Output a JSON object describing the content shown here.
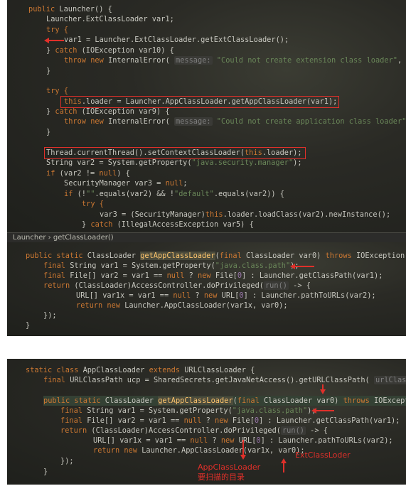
{
  "panel1": {
    "l1": [
      "public",
      " Launcher() {"
    ],
    "l2": "Launcher.ExtClassLoader var1;",
    "l3": "try {",
    "l4": "var1 = Launcher.ExtClassLoader.getExtClassLoader();",
    "l5": [
      "} ",
      "catch",
      " (IOException var10) {"
    ],
    "l6": [
      "throw new",
      " InternalError( ",
      "message:",
      " \"Could not create extension class loader\"",
      ", var"
    ],
    "l7": "}",
    "l8": "try {",
    "l9": [
      "this",
      ".loader = Launcher.AppClassLoader.getAppClassLoader(var1);"
    ],
    "l10": [
      "} ",
      "catch",
      " (IOException var9) {"
    ],
    "l11": [
      "throw new",
      " InternalError( ",
      "message:",
      " \"Could not create application class loader\"",
      ", v"
    ],
    "l12": "}",
    "l13": [
      "Thread.currentThread().setContextClassLoader(",
      "this",
      ".loader);"
    ],
    "l14": [
      "String var2 = System.getProperty(",
      "\"java.security.manager\"",
      ");"
    ],
    "l15": [
      "if",
      " (var2 != ",
      "null",
      ") {"
    ],
    "l16": [
      "SecurityManager var3 = ",
      "null",
      ";"
    ],
    "l17": [
      "if",
      " (!",
      "\"\"",
      ".equals(var2) && !",
      "\"default\"",
      ".equals(var2)) {"
    ],
    "l18": "try {",
    "l19": [
      "var3 = (SecurityManager)",
      "this",
      ".loader.loadClass(var2).newInstance();"
    ],
    "l20": [
      "} ",
      "catch",
      " (IllegalAccessException var5) {"
    ]
  },
  "breadcrumb": {
    "item1": "Launcher",
    "sep": "›",
    "item2": "getClassLoader()"
  },
  "panel1b": {
    "m1": [
      "public static",
      " ClassLoader ",
      "getAppClassLoader",
      "(",
      "final",
      " ClassLoader var0) ",
      "throws",
      " IOException {"
    ],
    "m2": [
      "final",
      " String var1 = System.getProperty(",
      "\"java.class.path\"",
      ");"
    ],
    "m3": [
      "final",
      " File[] var2 = var1 == ",
      "null",
      " ? ",
      "new",
      " File[",
      "0",
      "] : Launcher.getClassPath(var1);"
    ],
    "m4": [
      "return",
      " (ClassLoader)AccessController.doPrivileged(",
      "run()",
      " -> {"
    ],
    "m5": [
      "URL[] var1x = var1 == ",
      "null",
      " ? ",
      "new",
      " URL[",
      "0",
      "] : Launcher.pathToURLs(var2);"
    ],
    "m6": [
      "return new",
      " Launcher.AppClassLoader(var1x, var0);"
    ],
    "m7": "});",
    "m8": "}"
  },
  "panel2": {
    "n1": [
      "static class",
      " AppClassLoader ",
      "extends",
      " URLClassLoader {"
    ],
    "n2": [
      "final",
      " URLClassPath ucp = SharedSecrets.getJavaNetAccess().getURLClassPath( ",
      "urlClassLoad"
    ],
    "n3": [
      "public static",
      " ClassLoader ",
      "getAppClassLoader",
      "(",
      "final",
      " ClassLoader var0) ",
      "throws",
      " IOExceptio"
    ],
    "n4": [
      "final",
      " String var1 = System.getProperty(",
      "\"java.class.path\"",
      ");"
    ],
    "n5": [
      "final",
      " File[] var2 = var1 == ",
      "null",
      " ? ",
      "new",
      " File[",
      "0",
      "] : Launcher.getClassPath(var1);"
    ],
    "n6": [
      "return",
      " (ClassLoader)AccessController.doPrivileged(",
      "run()",
      " -> {"
    ],
    "n7": [
      "URL[] var1x = var1 == ",
      "null",
      " ? ",
      "new",
      " URL[",
      "0",
      "] : Launcher.pathToURLs(var2);"
    ],
    "n8": [
      "return new",
      " Launcher.AppClassLoader(var1x, var0);"
    ],
    "n9": "});",
    "n10": "}"
  },
  "annotations": {
    "ext": "ExtClassLoder",
    "app1": "AppClassLoader",
    "app2": "要扫描的目录"
  },
  "colors": {
    "keyword": "#cc7832",
    "string": "#6a8759",
    "method": "#ffc66d",
    "annotation": "#e0302a"
  }
}
